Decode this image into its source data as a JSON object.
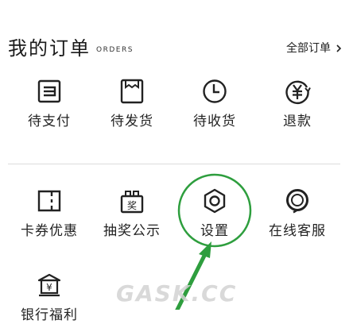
{
  "orders": {
    "title": "我的订单",
    "subtitle": "ORDERS",
    "all_orders_label": "全部订单",
    "items": [
      {
        "label": "待支付",
        "icon": "wallet-icon"
      },
      {
        "label": "待发货",
        "icon": "package-icon"
      },
      {
        "label": "待收货",
        "icon": "clock-icon"
      },
      {
        "label": "退款",
        "icon": "yen-refund-icon"
      }
    ]
  },
  "services": {
    "items": [
      {
        "label": "卡券优惠",
        "icon": "coupon-icon"
      },
      {
        "label": "抽奖公示",
        "icon": "lottery-icon",
        "icon_text": "奖"
      },
      {
        "label": "设置",
        "icon": "hexagon-nut-icon"
      },
      {
        "label": "在线客服",
        "icon": "headset-icon"
      },
      {
        "label": "银行福利",
        "icon": "bank-icon",
        "icon_text": "¥"
      }
    ]
  },
  "annotation": {
    "color": "#2e9e3e"
  },
  "watermark": "GASK.CC"
}
